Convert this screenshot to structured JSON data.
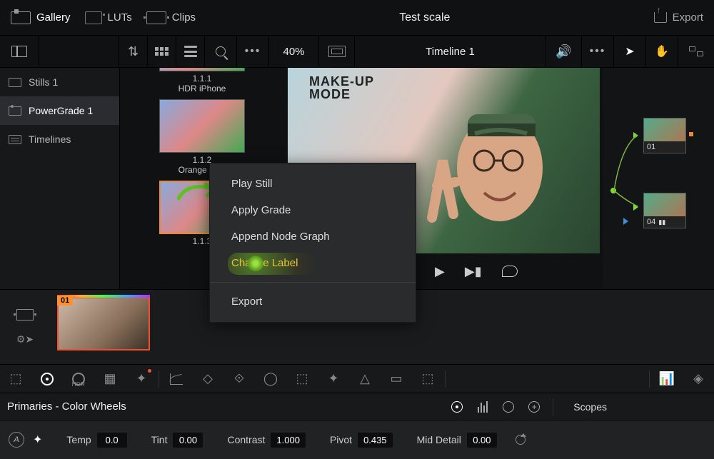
{
  "top": {
    "tabs": [
      {
        "label": "Gallery",
        "active": true
      },
      {
        "label": "LUTs",
        "active": false
      },
      {
        "label": "Clips",
        "active": false
      }
    ],
    "project": "Test scale",
    "export": "Export"
  },
  "second": {
    "zoom": "40%",
    "timeline": "Timeline 1"
  },
  "sidebar": [
    {
      "label": "Stills 1",
      "active": false
    },
    {
      "label": "PowerGrade 1",
      "active": true
    },
    {
      "label": "Timelines",
      "active": false
    }
  ],
  "gallery": [
    {
      "num": "1.1.1",
      "name": "HDR iPhone"
    },
    {
      "num": "1.1.2",
      "name": "Orange & …"
    },
    {
      "num": "1.1.3",
      "name": ""
    }
  ],
  "makeup": "MAKE-UP\nMODE",
  "context": [
    {
      "label": "Play Still"
    },
    {
      "label": "Apply Grade"
    },
    {
      "label": "Append Node Graph"
    },
    {
      "label": "Change Label",
      "highlight": true
    },
    {
      "sep": true
    },
    {
      "label": "Export"
    }
  ],
  "nodes": [
    {
      "label": "01"
    },
    {
      "label": "04"
    }
  ],
  "clip": {
    "badge": "01"
  },
  "primaries": {
    "title": "Primaries - Color Wheels",
    "scopes": "Scopes"
  },
  "params": {
    "a": "A",
    "items": [
      {
        "label": "Temp",
        "value": "0.0"
      },
      {
        "label": "Tint",
        "value": "0.00"
      },
      {
        "label": "Contrast",
        "value": "1.000"
      },
      {
        "label": "Pivot",
        "value": "0.435"
      },
      {
        "label": "Mid Detail",
        "value": "0.00"
      }
    ]
  }
}
